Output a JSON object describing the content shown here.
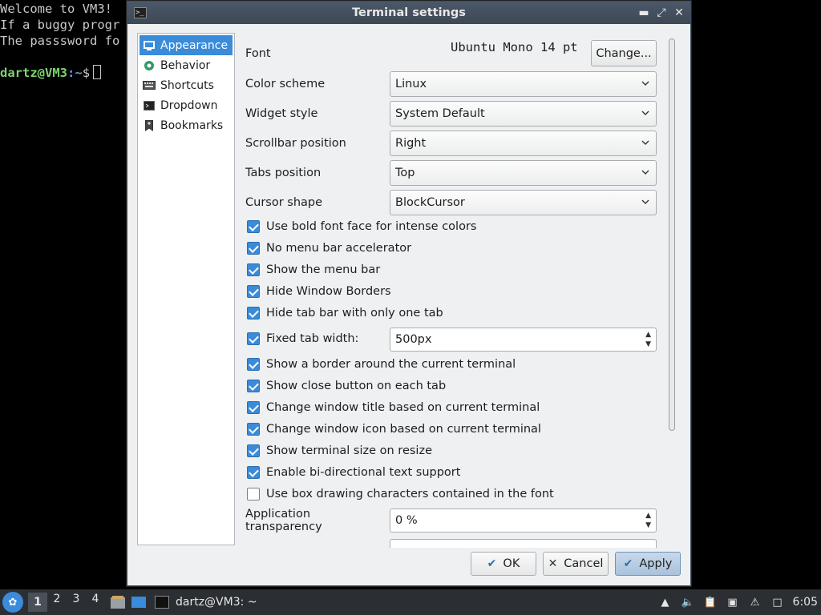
{
  "terminal": {
    "lines": [
      "Welcome to VM3!",
      "If a buggy progr",
      "The passsword fo",
      ""
    ],
    "prompt_user": "dartz@VM3",
    "prompt_sep": ":",
    "prompt_path": "~",
    "prompt_end": "$"
  },
  "dialog": {
    "title": "Terminal settings",
    "controls": {
      "minimize": "▬",
      "maximize": "⤢",
      "close": "✕"
    }
  },
  "sidebar": {
    "items": [
      {
        "label": "Appearance",
        "icon": "appearance-icon",
        "active": true
      },
      {
        "label": "Behavior",
        "icon": "behavior-icon",
        "active": false
      },
      {
        "label": "Shortcuts",
        "icon": "keyboard-icon",
        "active": false
      },
      {
        "label": "Dropdown",
        "icon": "terminal-icon",
        "active": false
      },
      {
        "label": "Bookmarks",
        "icon": "bookmark-icon",
        "active": false
      }
    ]
  },
  "appearance": {
    "font_label": "Font",
    "font_value": "Ubuntu Mono 14 pt",
    "font_change": "Change...",
    "color_scheme_label": "Color scheme",
    "color_scheme_value": "Linux",
    "widget_style_label": "Widget style",
    "widget_style_value": "System Default",
    "scrollbar_label": "Scrollbar position",
    "scrollbar_value": "Right",
    "tabs_label": "Tabs position",
    "tabs_value": "Top",
    "cursor_label": "Cursor shape",
    "cursor_value": "BlockCursor",
    "checks": [
      {
        "label": "Use bold font face for intense colors",
        "checked": true
      },
      {
        "label": "No menu bar accelerator",
        "checked": true
      },
      {
        "label": "Show the menu bar",
        "checked": true
      },
      {
        "label": "Hide Window Borders",
        "checked": true
      },
      {
        "label": "Hide tab bar with only one tab",
        "checked": true
      }
    ],
    "fixed_tab_label": "Fixed tab width:",
    "fixed_tab_checked": true,
    "fixed_tab_value": "500px",
    "checks2": [
      {
        "label": "Show a border around the current terminal",
        "checked": true
      },
      {
        "label": "Show close button on each tab",
        "checked": true
      },
      {
        "label": "Change window title based on current terminal",
        "checked": true
      },
      {
        "label": "Change window icon based on current terminal",
        "checked": true
      },
      {
        "label": "Show terminal size on resize",
        "checked": true
      },
      {
        "label": "Enable bi-directional text support",
        "checked": true
      },
      {
        "label": "Use box drawing characters contained in the font",
        "checked": false
      }
    ],
    "transparency_label": "Application transparency",
    "transparency_value": "0 %"
  },
  "buttons": {
    "ok": "OK",
    "cancel": "Cancel",
    "apply": "Apply"
  },
  "taskbar": {
    "workspaces": [
      "1",
      "2",
      "3",
      "4"
    ],
    "task_label": "dartz@VM3: ~",
    "clock": "6:05"
  },
  "colors": {
    "accent": "#3a8bd9",
    "titlebar": "#3d4856",
    "taskbar": "#2b2f33"
  }
}
